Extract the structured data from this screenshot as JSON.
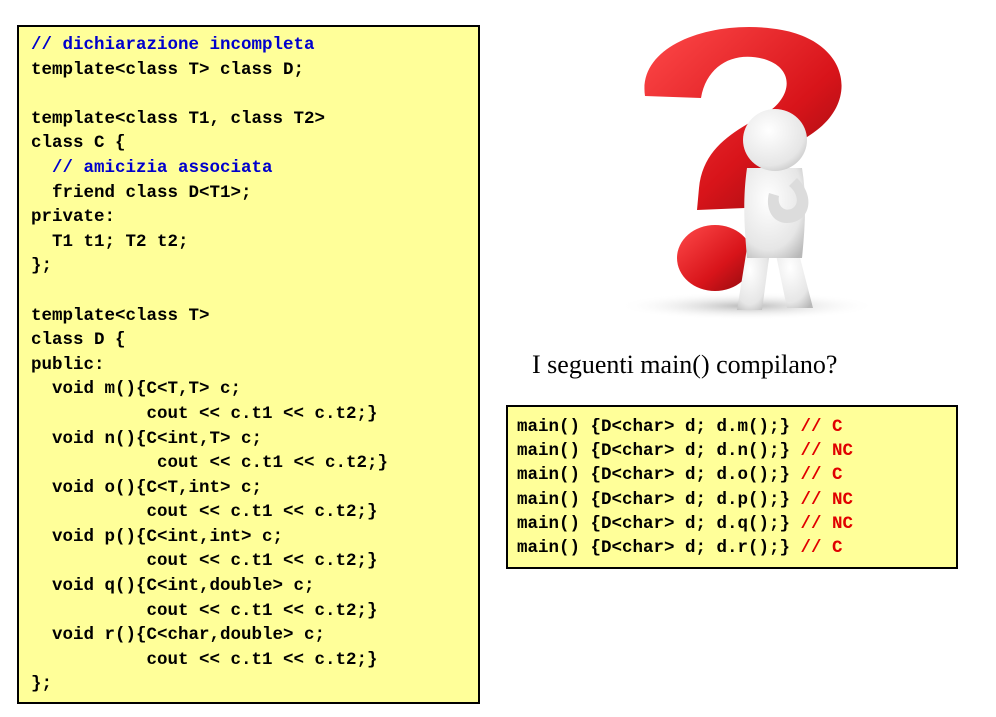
{
  "code_lines": [
    {
      "text": "// dichiarazione incompleta",
      "comment": true
    },
    {
      "text": "template<class T> class D;"
    },
    {
      "text": ""
    },
    {
      "text": "template<class T1, class T2>"
    },
    {
      "text": "class C {"
    },
    {
      "text": "  // amicizia associata",
      "comment": true
    },
    {
      "text": "  friend class D<T1>;"
    },
    {
      "text": "private:"
    },
    {
      "text": "  T1 t1; T2 t2;"
    },
    {
      "text": "};"
    },
    {
      "text": ""
    },
    {
      "text": "template<class T>"
    },
    {
      "text": "class D {"
    },
    {
      "text": "public:"
    },
    {
      "text": "  void m(){C<T,T> c;"
    },
    {
      "text": "           cout << c.t1 << c.t2;}"
    },
    {
      "text": "  void n(){C<int,T> c;"
    },
    {
      "text": "            cout << c.t1 << c.t2;}"
    },
    {
      "text": "  void o(){C<T,int> c;"
    },
    {
      "text": "           cout << c.t1 << c.t2;}"
    },
    {
      "text": "  void p(){C<int,int> c;"
    },
    {
      "text": "           cout << c.t1 << c.t2;}"
    },
    {
      "text": "  void q(){C<int,double> c;"
    },
    {
      "text": "           cout << c.t1 << c.t2;}"
    },
    {
      "text": "  void r(){C<char,double> c;"
    },
    {
      "text": "           cout << c.t1 << c.t2;}"
    },
    {
      "text": "};"
    }
  ],
  "question": "I seguenti main() compilano?",
  "main_lines": [
    {
      "code": "main() {D<char> d; d.m();} ",
      "result": "// C"
    },
    {
      "code": "main() {D<char> d; d.n();} ",
      "result": "// NC"
    },
    {
      "code": "main() {D<char> d; d.o();} ",
      "result": "// C"
    },
    {
      "code": "main() {D<char> d; d.p();} ",
      "result": "// NC"
    },
    {
      "code": "main() {D<char> d; d.q();} ",
      "result": "// NC"
    },
    {
      "code": "main() {D<char> d; d.r();} ",
      "result": "// C"
    }
  ],
  "figure": {
    "icon": "thinking-person-question-mark-icon",
    "mark_color": "#d8141a",
    "person_color": "#f2f2f2"
  }
}
